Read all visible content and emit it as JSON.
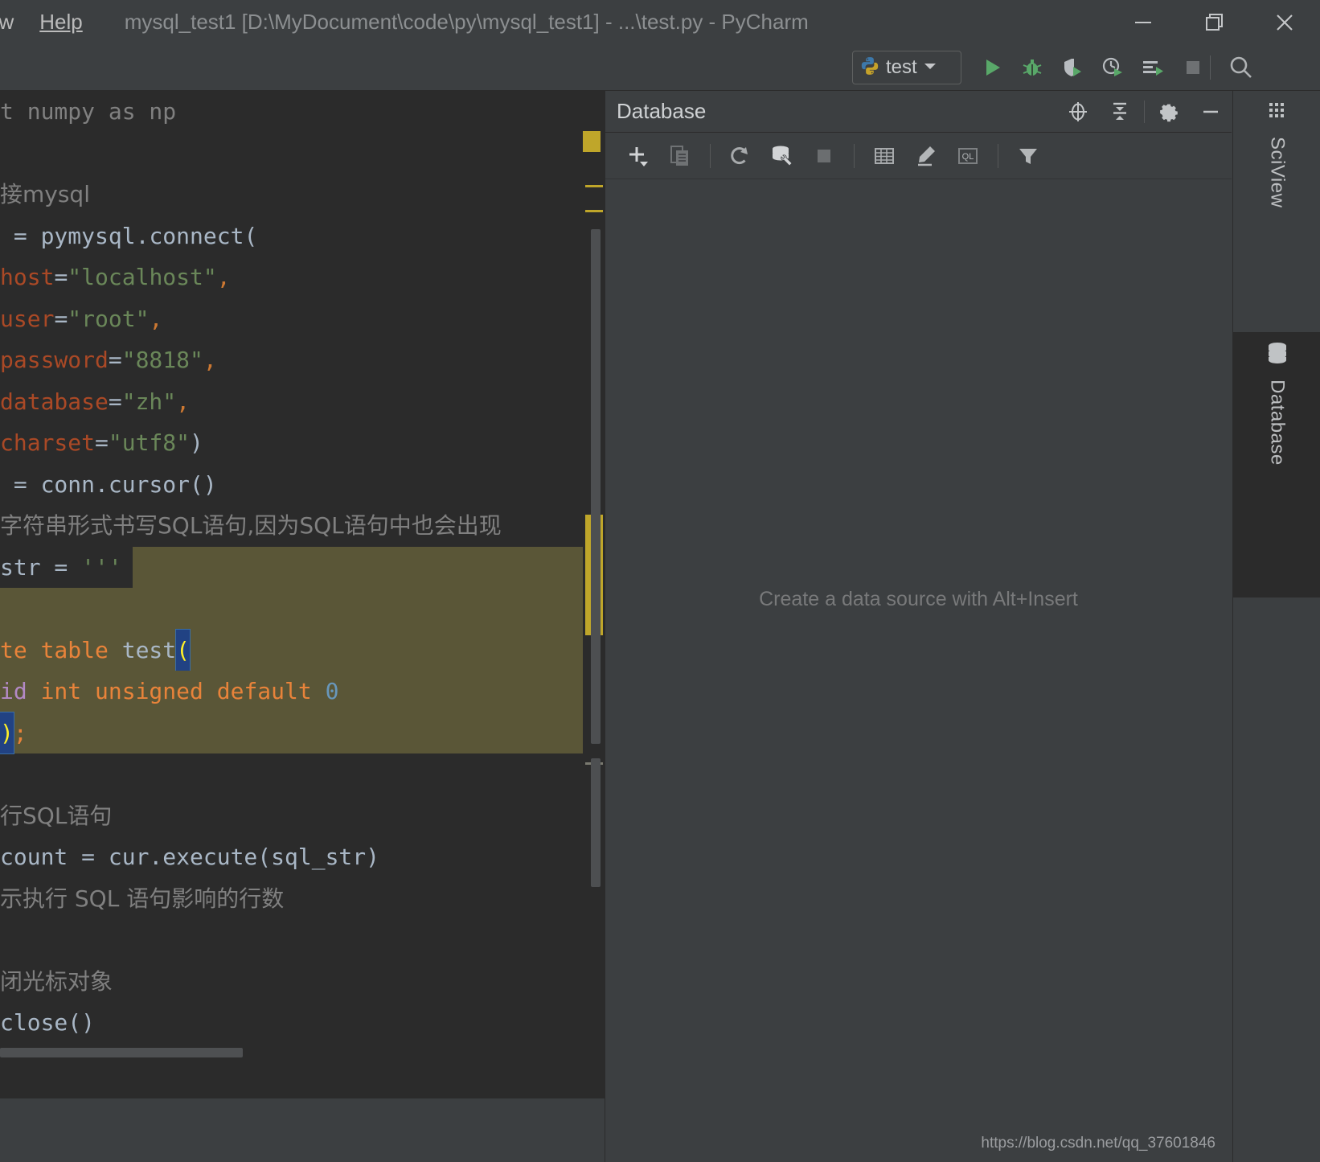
{
  "window": {
    "title": "mysql_test1 [D:\\MyDocument\\code\\py\\mysql_test1] - ...\\test.py - PyCharm",
    "menu": [
      {
        "label": "ow",
        "name": "menu-window"
      },
      {
        "label": "Help",
        "name": "menu-help"
      }
    ],
    "controls": {
      "minimize": "minimize-icon",
      "restore": "restore-icon",
      "close": "close-icon"
    }
  },
  "run_toolbar": {
    "config_name": "test",
    "config_icon": "python-icon",
    "dropdown_icon": "chevron-down-icon",
    "buttons": [
      {
        "name": "run-button",
        "icon": "play-icon",
        "color": "#59a869"
      },
      {
        "name": "debug-button",
        "icon": "bug-icon",
        "color": "#59a869"
      },
      {
        "name": "run-with-coverage-button",
        "icon": "coverage-icon",
        "color": "#59a869"
      },
      {
        "name": "profile-button",
        "icon": "profile-clock-icon",
        "color": "#59a869"
      },
      {
        "name": "run-concurrency-button",
        "icon": "concurrency-icon",
        "color": "#59a869"
      },
      {
        "name": "stop-button",
        "icon": "stop-square-icon",
        "color": "#6e7173"
      },
      {
        "name": "search-everywhere-button",
        "icon": "search-icon",
        "color": "#b0b3b5"
      }
    ]
  },
  "editor": {
    "language": "python",
    "lines": [
      {
        "id": "l1",
        "highlight": "none",
        "tokens": [
          {
            "t": "t numpy as np",
            "c": "k-com"
          }
        ]
      },
      {
        "id": "l2",
        "highlight": "none",
        "tokens": [
          {
            "t": "",
            "c": "k-id"
          }
        ]
      },
      {
        "id": "l3",
        "highlight": "none",
        "tokens": [
          {
            "t": "接mysql",
            "c": "k-zh"
          }
        ]
      },
      {
        "id": "l4",
        "highlight": "none",
        "tokens": [
          {
            "t": " = ",
            "c": "k-op"
          },
          {
            "t": "pymysql.connect(",
            "c": "k-id"
          }
        ]
      },
      {
        "id": "l5",
        "highlight": "none",
        "tokens": [
          {
            "t": "host",
            "c": "k-param"
          },
          {
            "t": "=",
            "c": "k-op"
          },
          {
            "t": "\"localhost\"",
            "c": "k-str"
          },
          {
            "t": ",",
            "c": "k-comma"
          }
        ]
      },
      {
        "id": "l6",
        "highlight": "none",
        "tokens": [
          {
            "t": "user",
            "c": "k-param"
          },
          {
            "t": "=",
            "c": "k-op"
          },
          {
            "t": "\"root\"",
            "c": "k-str"
          },
          {
            "t": ",",
            "c": "k-comma"
          }
        ]
      },
      {
        "id": "l7",
        "highlight": "none",
        "tokens": [
          {
            "t": "password",
            "c": "k-param"
          },
          {
            "t": "=",
            "c": "k-op"
          },
          {
            "t": "\"8818\"",
            "c": "k-str"
          },
          {
            "t": ",",
            "c": "k-comma"
          }
        ]
      },
      {
        "id": "l8",
        "highlight": "none",
        "tokens": [
          {
            "t": "database",
            "c": "k-param"
          },
          {
            "t": "=",
            "c": "k-op"
          },
          {
            "t": "\"zh\"",
            "c": "k-str"
          },
          {
            "t": ",",
            "c": "k-comma"
          }
        ]
      },
      {
        "id": "l9",
        "highlight": "none",
        "tokens": [
          {
            "t": "charset",
            "c": "k-param"
          },
          {
            "t": "=",
            "c": "k-op"
          },
          {
            "t": "\"utf8\"",
            "c": "k-str"
          },
          {
            "t": ")",
            "c": "k-id"
          }
        ]
      },
      {
        "id": "l10",
        "highlight": "none",
        "tokens": [
          {
            "t": " = ",
            "c": "k-op"
          },
          {
            "t": "conn.cursor()",
            "c": "k-id"
          }
        ]
      },
      {
        "id": "l11",
        "highlight": "none",
        "tokens": [
          {
            "t": "字符串形式书写SQL语句,因为SQL语句中也会出现",
            "c": "k-zh"
          }
        ]
      },
      {
        "id": "l12",
        "highlight": "partial",
        "tokens": [
          {
            "t": "str = ",
            "c": "k-id"
          },
          {
            "t": "'''",
            "c": "k-str"
          }
        ]
      },
      {
        "id": "l13",
        "highlight": "full",
        "tokens": [
          {
            "t": "",
            "c": "k-id"
          }
        ]
      },
      {
        "id": "l14",
        "highlight": "full",
        "tokens": [
          {
            "t": "te table ",
            "c": "k-sql-kw"
          },
          {
            "t": "test",
            "c": "k-sql-id"
          },
          {
            "t": "(",
            "c": "caret"
          }
        ]
      },
      {
        "id": "l15",
        "highlight": "full",
        "tokens": [
          {
            "t": "id",
            "c": "k-sql-col"
          },
          {
            "t": " int unsigned default ",
            "c": "k-sql-kw"
          },
          {
            "t": "0",
            "c": "k-num"
          }
        ]
      },
      {
        "id": "l16",
        "highlight": "full",
        "tokens": [
          {
            "t": ")",
            "c": "caret2"
          },
          {
            "t": ";",
            "c": "k-sql-kw"
          }
        ]
      },
      {
        "id": "l17",
        "highlight": "none",
        "tokens": [
          {
            "t": "",
            "c": "k-id"
          }
        ]
      },
      {
        "id": "l18",
        "highlight": "none",
        "tokens": [
          {
            "t": "行SQL语句",
            "c": "k-zh"
          }
        ]
      },
      {
        "id": "l19",
        "highlight": "none",
        "tokens": [
          {
            "t": "count = ",
            "c": "k-id"
          },
          {
            "t": "cur.execute(sql_str)",
            "c": "k-id"
          }
        ]
      },
      {
        "id": "l20",
        "highlight": "none",
        "tokens": [
          {
            "t": "示执行 SQL 语句影响的行数",
            "c": "k-zh"
          }
        ]
      },
      {
        "id": "l21",
        "highlight": "none",
        "tokens": [
          {
            "t": "",
            "c": "k-id"
          }
        ]
      },
      {
        "id": "l22",
        "highlight": "none",
        "tokens": [
          {
            "t": "闭光标对象",
            "c": "k-zh"
          }
        ]
      },
      {
        "id": "l23",
        "highlight": "none",
        "tokens": [
          {
            "t": "close()",
            "c": "k-id"
          }
        ]
      }
    ],
    "markers": {
      "warning_color": "#bfa62a",
      "gray_color": "#7a7a70"
    },
    "scrollbar": {
      "horizontal_visible": true,
      "vertical_visible": true
    }
  },
  "database_panel": {
    "title": "Database",
    "empty_message": "Create a data source with Alt+Insert",
    "header_actions": [
      {
        "name": "locate-data-source-button",
        "icon": "target-icon"
      },
      {
        "name": "collapse-all-button",
        "icon": "collapse-all-icon"
      },
      {
        "name": "settings-button",
        "icon": "gear-icon"
      },
      {
        "name": "hide-button",
        "icon": "minimize-icon"
      }
    ],
    "toolbar_actions": [
      {
        "name": "add-data-source-button",
        "icon": "plus-icon"
      },
      {
        "name": "duplicate-button",
        "icon": "copy-icon"
      },
      {
        "name": "refresh-button",
        "icon": "refresh-icon"
      },
      {
        "name": "data-source-properties-button",
        "icon": "database-wrench-icon"
      },
      {
        "name": "stop-button",
        "icon": "stop-square-icon"
      },
      {
        "name": "open-table-editor-button",
        "icon": "table-grid-icon"
      },
      {
        "name": "modify-object-button",
        "icon": "pencil-icon"
      },
      {
        "name": "jump-to-query-console-button",
        "icon": "ql-console-icon"
      },
      {
        "name": "filter-button",
        "icon": "funnel-icon"
      }
    ]
  },
  "right_stripe": {
    "tabs": [
      {
        "label": "SciView",
        "icon": "grid-icon",
        "active": false,
        "name": "stripe-tab-sciview"
      },
      {
        "label": "Database",
        "icon": "database-stack-icon",
        "active": true,
        "name": "stripe-tab-database"
      }
    ]
  },
  "watermark": {
    "text": "https://blog.csdn.net/qq_37601846"
  },
  "colors": {
    "background": "#3c3f41",
    "editor_background": "#2b2b2b",
    "accent_green": "#59a869",
    "highlight_sql": "#5a5637",
    "marker_yellow": "#bfa62a"
  }
}
